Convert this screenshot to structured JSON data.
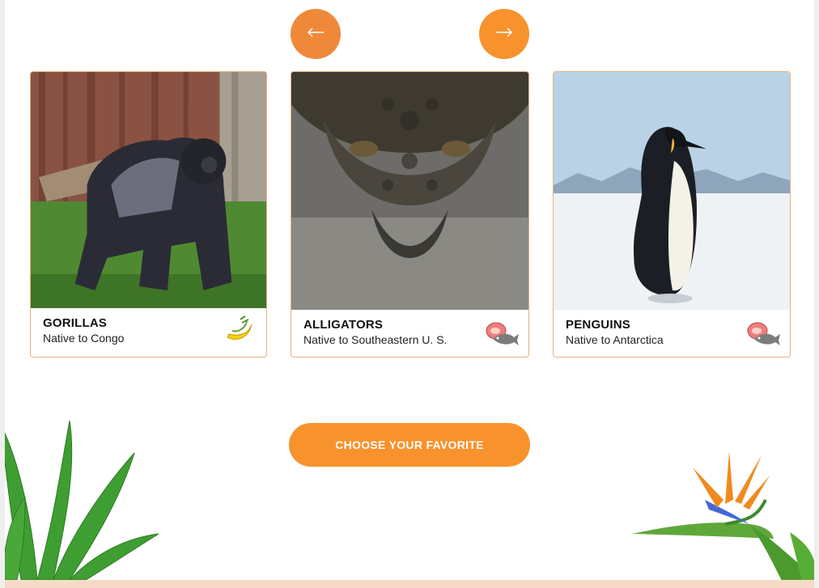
{
  "carousel": {
    "prev_icon": "arrow-left-icon",
    "next_icon": "arrow-right-icon",
    "cards": [
      {
        "title": "GORILLAS",
        "subtitle": "Native to Congo",
        "diet_icon": "banana-icon"
      },
      {
        "title": "ALLIGATORS",
        "subtitle": "Native to Southeastern U. S.",
        "diet_icon": "meat-fish-icon"
      },
      {
        "title": "PENGUINS",
        "subtitle": "Native to Antarctica",
        "diet_icon": "meat-fish-icon"
      }
    ]
  },
  "cta": {
    "label": "CHOOSE YOUR FAVORITE"
  },
  "colors": {
    "accent": "#f7922d",
    "accent_dark": "#f0883a",
    "card_border": "#e9b07f",
    "footer_strip": "#f7d9c8"
  }
}
